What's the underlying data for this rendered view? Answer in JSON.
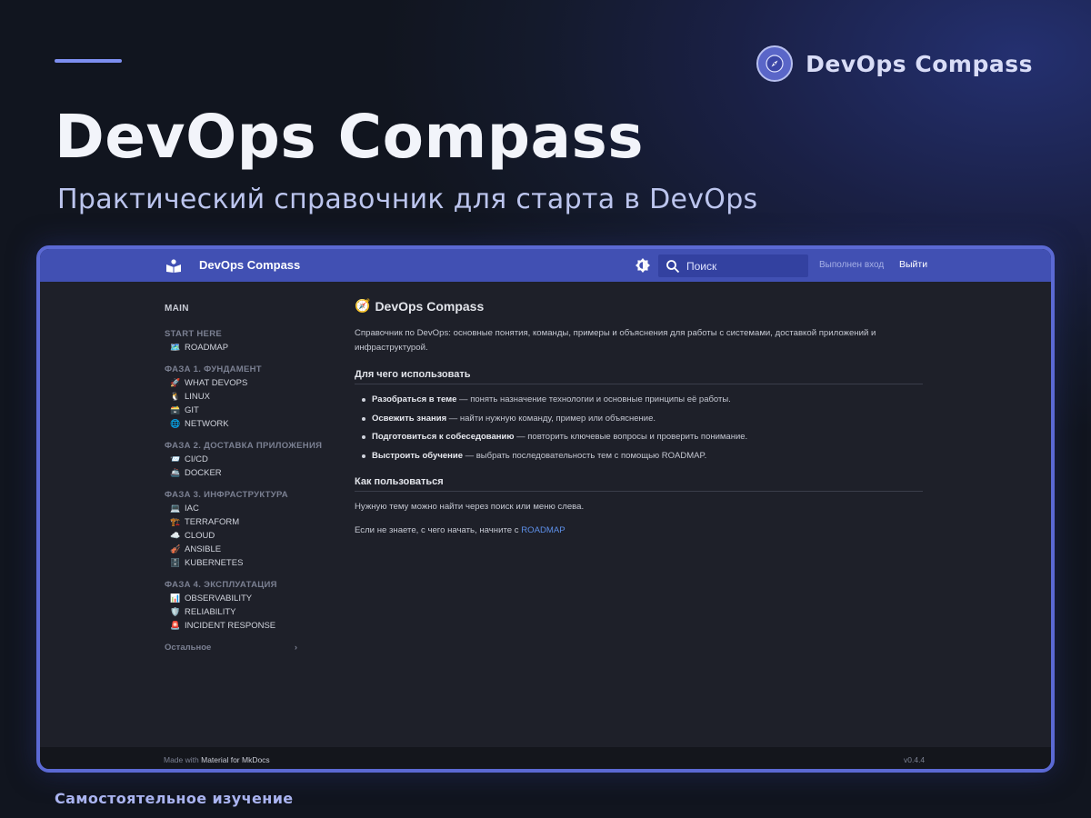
{
  "hero": {
    "title": "DevOps Compass",
    "subtitle": "Практический справочник для старта в DevOps",
    "brand_name": "DevOps Compass",
    "bottom_caption": "Самостоятельное изучение",
    "accent_color": "#7d8ef0"
  },
  "app": {
    "header": {
      "title": "DevOps Compass",
      "search_placeholder": "Поиск",
      "login_status": "Выполнен вход",
      "logout_label": "Выйти",
      "color": "#4150b3"
    },
    "sidebar": {
      "main_label": "MAIN",
      "sections": [
        {
          "title": "START HERE",
          "items": [
            {
              "icon": "🗺️",
              "label": "ROADMAP"
            }
          ]
        },
        {
          "title": "ФАЗА 1. ФУНДАМЕНТ",
          "items": [
            {
              "icon": "🚀",
              "label": "WHAT DEVOPS"
            },
            {
              "icon": "🐧",
              "label": "LINUX"
            },
            {
              "icon": "🗃️",
              "label": "GIT"
            },
            {
              "icon": "🌐",
              "label": "NETWORK"
            }
          ]
        },
        {
          "title": "ФАЗА 2. ДОСТАВКА ПРИЛОЖЕНИЯ",
          "items": [
            {
              "icon": "📨",
              "label": "CI/CD"
            },
            {
              "icon": "🚢",
              "label": "DOCKER"
            }
          ]
        },
        {
          "title": "ФАЗА 3. ИНФРАСТРУКТУРА",
          "items": [
            {
              "icon": "💻",
              "label": "IAC"
            },
            {
              "icon": "🏗️",
              "label": "TERRAFORM"
            },
            {
              "icon": "☁️",
              "label": "CLOUD"
            },
            {
              "icon": "🎻",
              "label": "ANSIBLE"
            },
            {
              "icon": "🗄️",
              "label": "KUBERNETES"
            }
          ]
        },
        {
          "title": "ФАЗА 4. ЭКСПЛУАТАЦИЯ",
          "items": [
            {
              "icon": "📊",
              "label": "OBSERVABILITY"
            },
            {
              "icon": "🛡️",
              "label": "RELIABILITY"
            },
            {
              "icon": "🚨",
              "label": "INCIDENT RESPONSE"
            }
          ]
        }
      ],
      "other_label": "Остальное",
      "other_arrow": "›"
    },
    "content": {
      "title_icon": "🧭",
      "title": "DevOps Compass",
      "intro": "Справочник по DevOps: основные понятия, команды, примеры и объяснения для работы с системами, доставкой приложений и инфраструктурой.",
      "h2_use": "Для чего использовать",
      "use_items": [
        {
          "bold": "Разобраться в теме",
          "rest": " — понять назначение технологии и основные принципы её работы."
        },
        {
          "bold": "Освежить знания",
          "rest": " — найти нужную команду, пример или объяснение."
        },
        {
          "bold": "Подготовиться к собеседованию",
          "rest": " — повторить ключевые вопросы и проверить понимание."
        },
        {
          "bold": "Выстроить обучение",
          "rest": " — выбрать последовательность тем с помощью ROADMAP."
        }
      ],
      "h2_how": "Как пользоваться",
      "how_p1": "Нужную тему можно найти через поиск или меню слева.",
      "how_p2_prefix": "Если не знаете, с чего начать, начните с ",
      "how_p2_link": "ROADMAP"
    },
    "footer": {
      "made_with_prefix": "Made with ",
      "made_with_link": "Material for MkDocs",
      "version": "v0.4.4"
    }
  }
}
